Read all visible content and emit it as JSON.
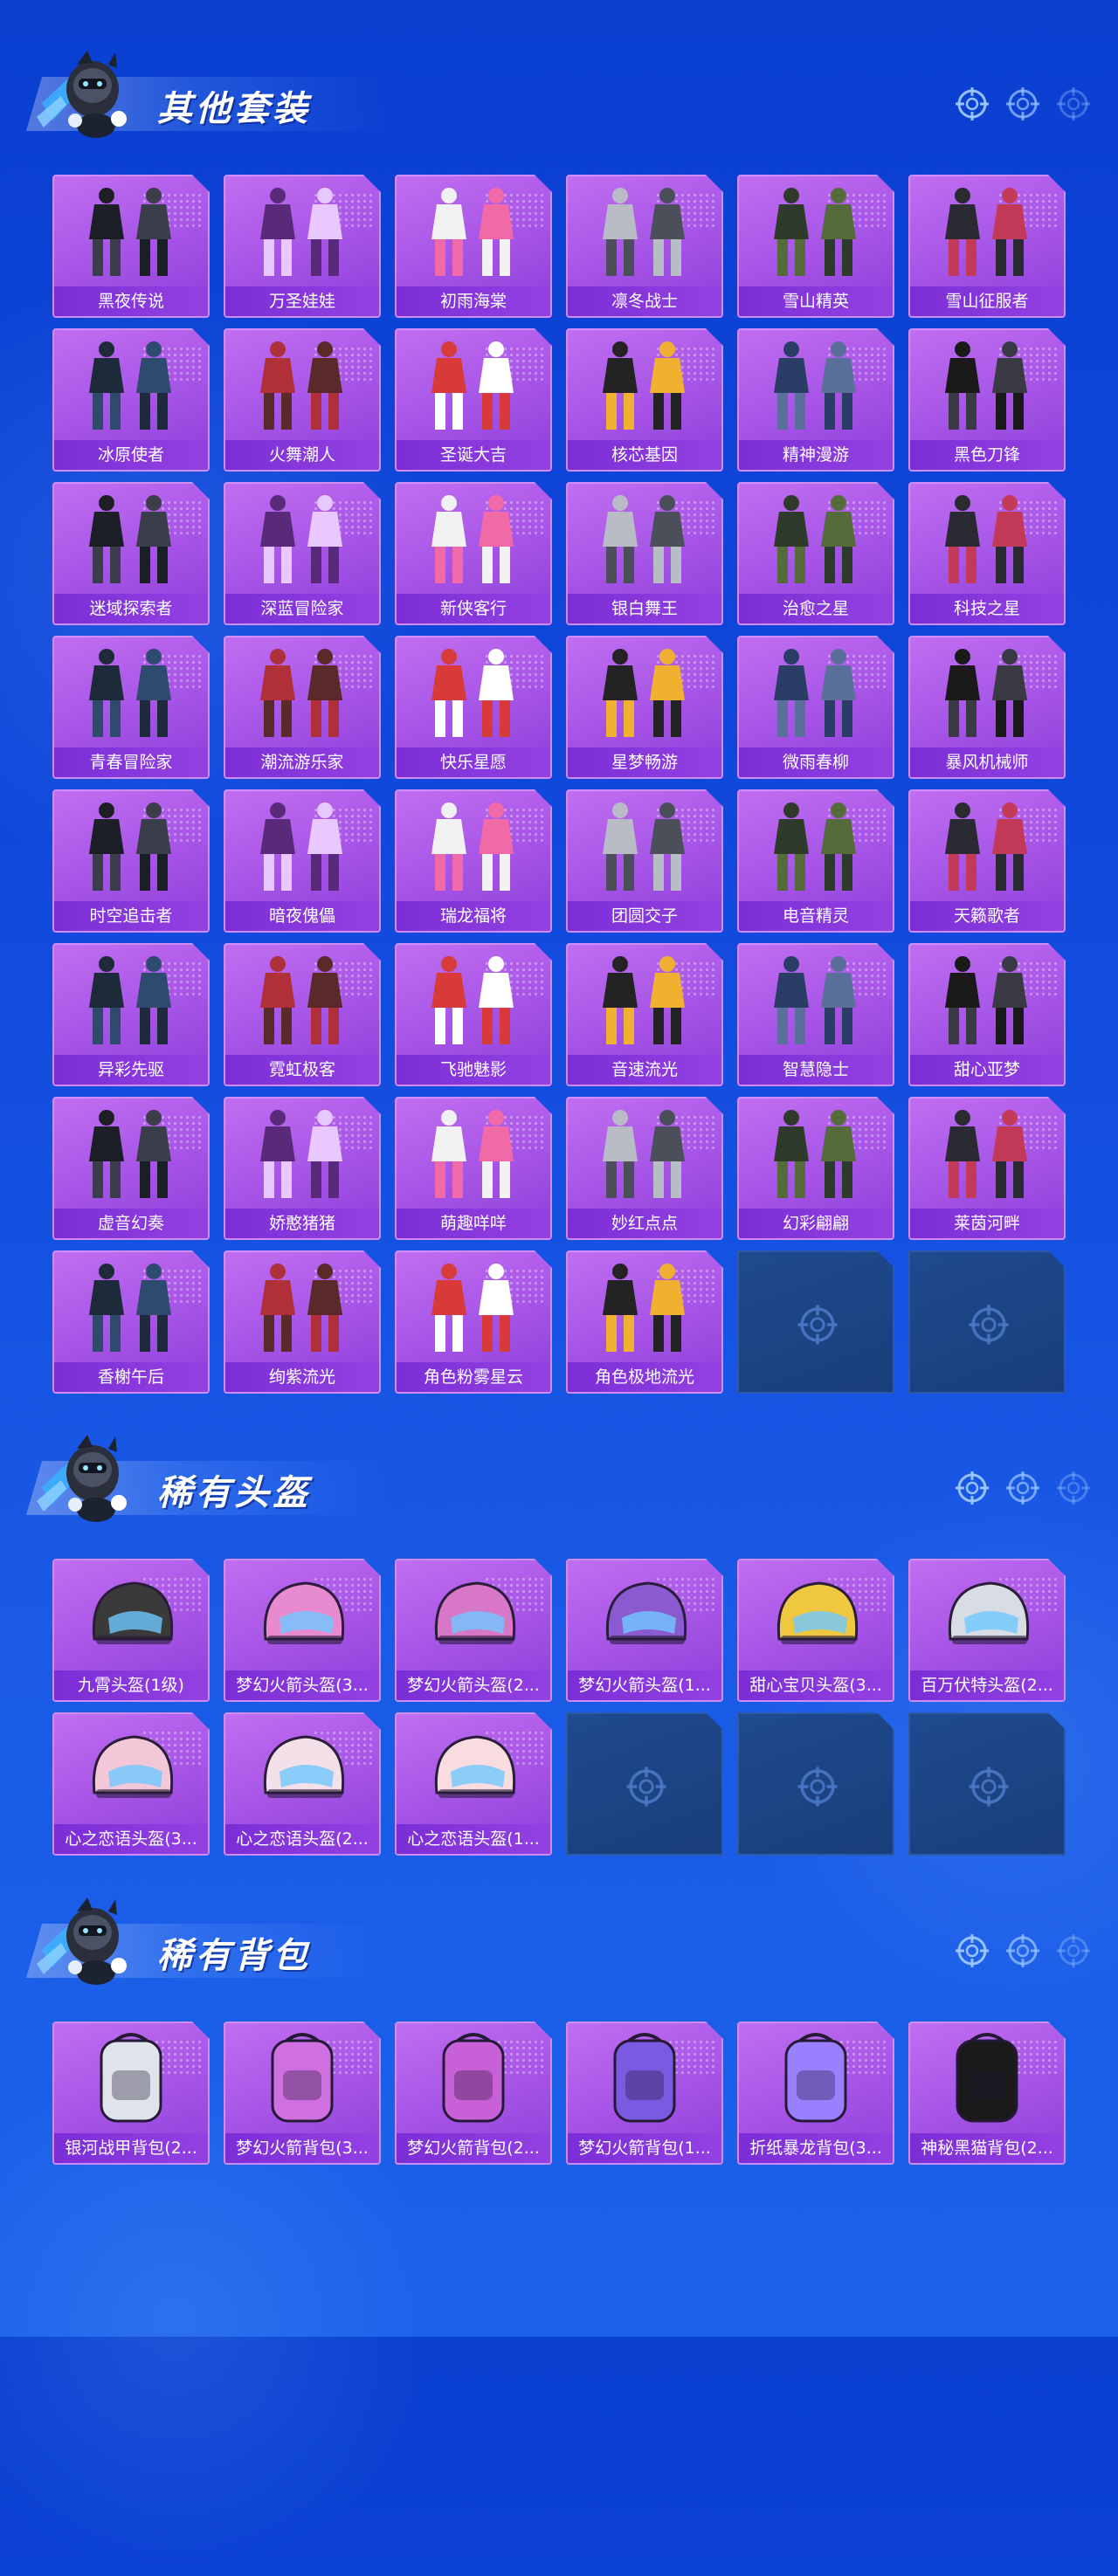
{
  "sections": [
    {
      "id": "outfits",
      "title": "其他套装",
      "items": [
        "黑夜传说",
        "万圣娃娃",
        "初雨海棠",
        "凛冬战士",
        "雪山精英",
        "雪山征服者",
        "冰原使者",
        "火舞潮人",
        "圣诞大吉",
        "核芯基因",
        "精神漫游",
        "黑色刀锋",
        "迷域探索者",
        "深蓝冒险家",
        "新侠客行",
        "银白舞王",
        "治愈之星",
        "科技之星",
        "青春冒险家",
        "潮流游乐家",
        "快乐星愿",
        "星梦畅游",
        "微雨春柳",
        "暴风机械师",
        "时空追击者",
        "暗夜傀儡",
        "瑞龙福将",
        "团圆交子",
        "电音精灵",
        "天籁歌者",
        "异彩先驱",
        "霓虹极客",
        "飞驰魅影",
        "音速流光",
        "智慧隐士",
        "甜心亚梦",
        "虚音幻奏",
        "娇憨猪猪",
        "萌趣咩咩",
        "妙红点点",
        "幻彩翩翩",
        "莱茵河畔",
        "香榭午后",
        "绚紫流光",
        "角色粉雾星云",
        "角色极地流光"
      ],
      "empty_slots": 2
    },
    {
      "id": "helmets",
      "title": "稀有头盔",
      "items": [
        "九霄头盔(1级)",
        "梦幻火箭头盔(3...",
        "梦幻火箭头盔(2...",
        "梦幻火箭头盔(1...",
        "甜心宝贝头盔(3...",
        "百万伏特头盔(2...",
        "心之恋语头盔(3...",
        "心之恋语头盔(2...",
        "心之恋语头盔(1..."
      ],
      "empty_slots": 3
    },
    {
      "id": "backpacks",
      "title": "稀有背包",
      "items": [
        "银河战甲背包(2...",
        "梦幻火箭背包(3...",
        "梦幻火箭背包(2...",
        "梦幻火箭背包(1...",
        "折纸暴龙背包(3...",
        "神秘黑猫背包(2..."
      ],
      "empty_slots": 0
    }
  ],
  "icons": {
    "section_mascot": "mascot-icon",
    "section_decor": "crosshair-icon",
    "empty_slot": "crosshair-icon"
  },
  "colors": {
    "background": "#0a3fd0",
    "card_purple": "#a553e6",
    "label_purple": "#7b2ed6",
    "empty_slot": "#1f4a8e"
  }
}
